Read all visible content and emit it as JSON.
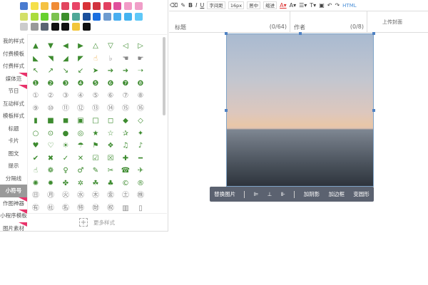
{
  "palette": [
    "#4a7bd0",
    "#f5e04a",
    "#f5c242",
    "#f08c35",
    "#e2455f",
    "#e84467",
    "#d83238",
    "#d1323e",
    "#e24060",
    "#e04f9c",
    "#f29bc7",
    "#f09ec8",
    "#d3e068",
    "#aadc3c",
    "#68d02e",
    "#7cc24f",
    "#3c8f2b",
    "#4fa898",
    "#1a4f9c",
    "#1b6fe0",
    "#6d9bd0",
    "#48aef0",
    "#44b3f0",
    "#5fc8f8",
    "#cccccc",
    "#999999",
    "#5a6472",
    "#111111",
    "#111111",
    "#f2c63a",
    "#111111"
  ],
  "sidebar": {
    "tabs": [
      {
        "label": "我的样式"
      },
      {
        "label": "付费模板"
      },
      {
        "label": "付费样式"
      },
      {
        "label": "媒体范",
        "flag": true
      },
      {
        "label": "节日",
        "flag": true
      },
      {
        "label": "互动样式"
      },
      {
        "label": "模板样式"
      },
      {
        "label": "标题"
      },
      {
        "label": "卡片"
      },
      {
        "label": "图文"
      },
      {
        "label": "提示"
      },
      {
        "label": "分隔线"
      },
      {
        "label": "小符号",
        "active": true
      },
      {
        "label": "作图神器",
        "flag": true
      },
      {
        "label": "小程序模板",
        "flag": true
      },
      {
        "label": "图片素材",
        "flag": true
      }
    ]
  },
  "symbols": [
    [
      "▲",
      "▼",
      "◀",
      "▶",
      "△",
      "▽",
      "◁",
      "▷"
    ],
    [
      "◣",
      "◥",
      "◢",
      "◤",
      "☝",
      "♭",
      "☚",
      "☛"
    ],
    [
      "↖",
      "↗",
      "↘",
      "↙",
      "➤",
      "➔",
      "➜",
      "➝"
    ],
    [
      "❶",
      "❷",
      "❸",
      "❹",
      "❺",
      "❻",
      "❼",
      "❽"
    ],
    [
      "①",
      "②",
      "③",
      "④",
      "⑤",
      "⑥",
      "⑦",
      "⑧"
    ],
    [
      "⑨",
      "⑩",
      "⑪",
      "⑫",
      "⑬",
      "⑭",
      "⑮",
      "⑯"
    ],
    [
      "▮",
      "■",
      "◼",
      "▣",
      "□",
      "◻",
      "◆",
      "◇"
    ],
    [
      "○",
      "⊙",
      "●",
      "◎",
      "★",
      "☆",
      "✰",
      "✦"
    ],
    [
      "♥",
      "♡",
      "☀",
      "☂",
      "⚑",
      "❖",
      "♫",
      "♪"
    ],
    [
      "✔",
      "✖",
      "✓",
      "✕",
      "☑",
      "☒",
      "✚",
      "━"
    ],
    [
      "☝",
      "❁",
      "♀",
      "♂",
      "✎",
      "✂",
      "☎",
      "✈"
    ],
    [
      "✺",
      "✹",
      "✤",
      "✲",
      "☘",
      "♣",
      "©",
      "®"
    ],
    [
      "㊐",
      "㊊",
      "㊋",
      "㊌",
      "㊍",
      "㊎",
      "㊏",
      "㊑"
    ],
    [
      "㊒",
      "㊓",
      "㊔",
      "㊕",
      "㊖",
      "㊗",
      "▥",
      "▯"
    ]
  ],
  "more_label": "更多样式",
  "toolbar": {
    "bold": "B",
    "italic": "I",
    "underline": "U",
    "letter_spacing": "字间距",
    "font_size": "16px",
    "center": "居中",
    "indent": "缩进",
    "font_color": "A▾",
    "bg_color": "A▾",
    "list": "☰▾",
    "heading": "T▾",
    "image": "▣",
    "undo": "↶",
    "redo": "↷",
    "html": "HTML"
  },
  "fields": {
    "title_placeholder": "标题",
    "title_count": "(0/64)",
    "author_placeholder": "作者",
    "author_count": "(0/8)",
    "upload_cover": "上传封面"
  },
  "image_toolbar": {
    "replace": "替换图片",
    "align_left": "⊫",
    "align_center": "⊥",
    "align_right": "⊪",
    "shadow": "加阴影",
    "border": "加边框",
    "transform": "变圆形"
  }
}
